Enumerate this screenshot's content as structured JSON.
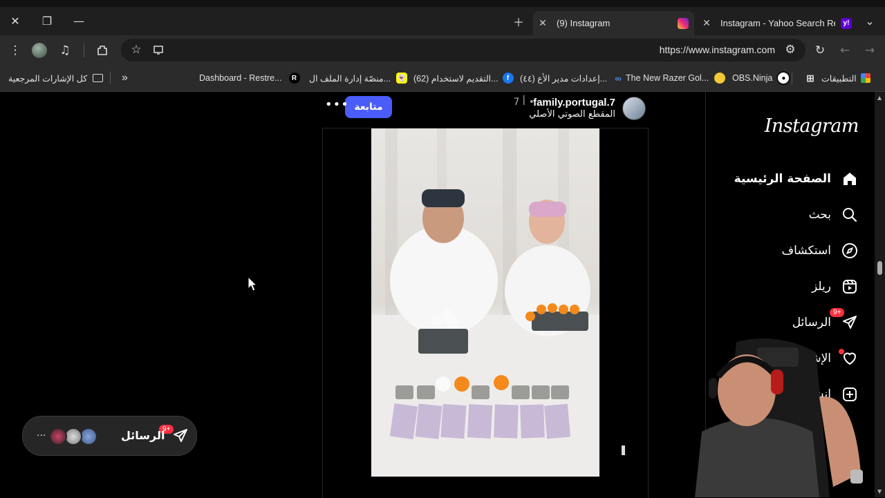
{
  "browser": {
    "tabs": [
      {
        "title": "(9) Instagram",
        "active": true
      },
      {
        "title": "Instagram - Yahoo Search Resul",
        "active": false
      }
    ],
    "url": "https://www.instagram.com",
    "bookmarks": [
      {
        "label": "التطبيقات",
        "icon": "apps-grid-icon"
      },
      {
        "label": "OBS.Ninja",
        "icon": "obs-icon"
      },
      {
        "label": "The New Razer Gol...",
        "icon": "razer-icon"
      },
      {
        "label": "(٤٤) إعدادات مدير الأع...",
        "icon": "meta-icon"
      },
      {
        "label": "(62) التقديم لاستخدام...",
        "icon": "facebook-icon"
      },
      {
        "label": "منصّة إدارة الملف ال...",
        "icon": "snapchat-icon"
      },
      {
        "label": "Dashboard - Restre...",
        "icon": "restream-icon"
      },
      {
        "label": "كل الإشارات المرجعية",
        "icon": "folder-icon"
      }
    ]
  },
  "instagram": {
    "logo": "Instagram",
    "nav": [
      {
        "label": "الصفحة الرئيسية",
        "icon": "home-icon"
      },
      {
        "label": "بحث",
        "icon": "search-icon"
      },
      {
        "label": "استكشاف",
        "icon": "explore-icon"
      },
      {
        "label": "ريلز",
        "icon": "reels-icon"
      },
      {
        "label": "الرسائل",
        "icon": "messages-icon",
        "badge": "9+"
      },
      {
        "label": "الإشعارات",
        "icon": "heart-icon"
      },
      {
        "label": "إنشاء",
        "icon": "create-icon"
      }
    ],
    "post": {
      "username": "family.portugal.7",
      "time": "7 أ",
      "separator": "•",
      "audio": "المقطع الصوتي الأصلي",
      "follow_label": "متابعة",
      "more": "•••"
    },
    "messages_pill": {
      "label": "الرسائل",
      "badge": "9+",
      "more": "..."
    }
  }
}
